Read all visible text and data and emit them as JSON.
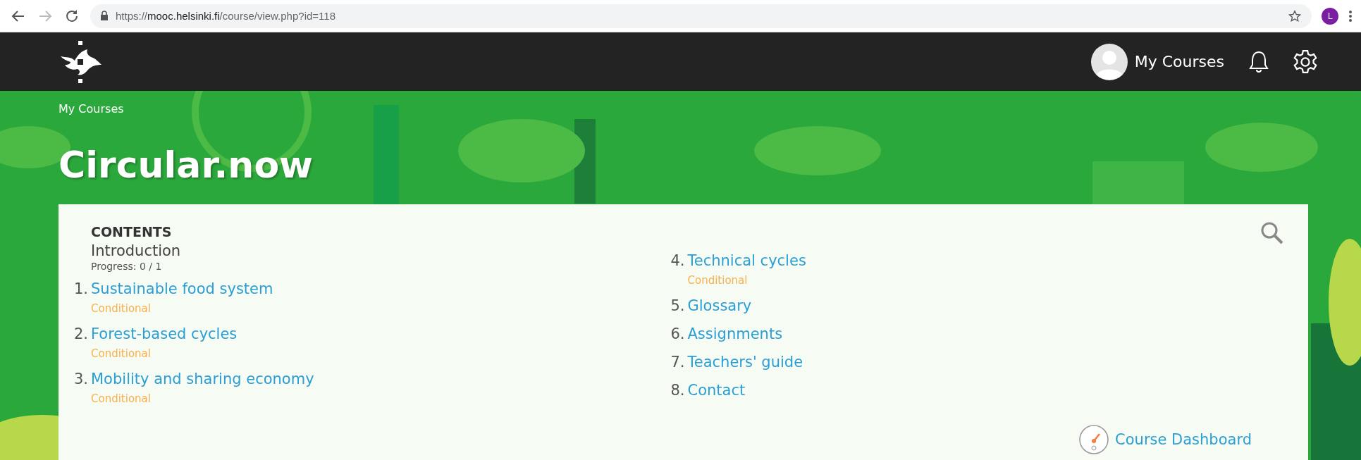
{
  "browser": {
    "url_scheme": "https://",
    "url_host": "mooc.helsinki.fi",
    "url_path": "/course/view.php?id=118",
    "profile_initial": "L"
  },
  "header": {
    "user_label": "My Courses"
  },
  "breadcrumb": "My Courses",
  "title": "Circular.now",
  "contents": {
    "heading": "CONTENTS",
    "intro": {
      "title": "Introduction",
      "progress": "Progress: 0 / 1"
    },
    "columns": [
      [
        {
          "number": "1.",
          "title": "Sustainable food system",
          "status": "Conditional"
        },
        {
          "number": "2.",
          "title": "Forest-based cycles",
          "status": "Conditional"
        },
        {
          "number": "3.",
          "title": "Mobility and sharing economy",
          "status": "Conditional"
        }
      ],
      [
        {
          "number": "4.",
          "title": "Technical cycles",
          "status": "Conditional"
        },
        {
          "number": "5.",
          "title": "Glossary"
        },
        {
          "number": "6.",
          "title": "Assignments"
        },
        {
          "number": "7.",
          "title": "Teachers' guide"
        },
        {
          "number": "8.",
          "title": "Contact"
        }
      ]
    ],
    "dashboard_link": "Course Dashboard"
  }
}
